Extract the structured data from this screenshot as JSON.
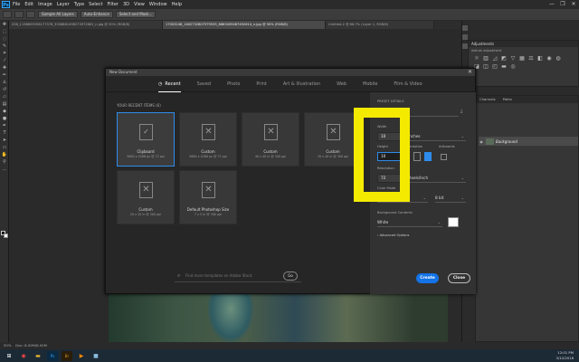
{
  "menubar": {
    "logo": "Ps",
    "items": [
      "File",
      "Edit",
      "Image",
      "Layer",
      "Type",
      "Select",
      "Filter",
      "3D",
      "View",
      "Window",
      "Help"
    ],
    "window_controls": [
      "—",
      "❐",
      "✕"
    ]
  },
  "optionsbar": {
    "buttons": [
      "Sample All Layers",
      "Auto-Enhance",
      "Select and Mask..."
    ]
  },
  "doc_tabs": [
    "036_1138609356177378_3336861498273972661_n.jpg @ 50% (RGB/8)",
    "17003248_1462732807979555_6863459487492614_n.jpg @ 50% (RGB/8)",
    "Untitled-2 @ 66.7% (Layer 1, RGB/8)"
  ],
  "adjustments": {
    "title": "Adjustments",
    "subtitle": "Add an adjustment"
  },
  "layers": {
    "tabs": [
      "Channels",
      "Paths"
    ],
    "background_label": "Background"
  },
  "statusbar": {
    "zoom": "50%",
    "doc": "Doc: 8.00M/8.00M"
  },
  "taskbar": {
    "time": "12:01 PM",
    "date": "3/12/2018"
  },
  "dialog": {
    "title": "New Document",
    "close": "✕",
    "tabs": [
      "Recent",
      "Saved",
      "Photo",
      "Print",
      "Art & Illustration",
      "Web",
      "Mobile",
      "Film & Video"
    ],
    "recent_header": "YOUR RECENT ITEMS (6)",
    "cards": [
      {
        "name": "Clipboard",
        "size": "5680 x 4288 px @ 72 ppi"
      },
      {
        "name": "Custom",
        "size": "5680 x 4288 px @ 72 ppi"
      },
      {
        "name": "Custom",
        "size": "40 x 40 in @ 300 ppi"
      },
      {
        "name": "Custom",
        "size": "20 x 40 in @ 300 ppi"
      },
      {
        "name": "Custom",
        "size": "20 x 20 in @ 300 ppi"
      },
      {
        "name": "Default Photoshop Size",
        "size": "7 x 5 in @ 300 ppi"
      }
    ],
    "search_placeholder": "Find more templates on Adobe Stock",
    "go": "Go",
    "preset": {
      "header": "PRESET DETAILS",
      "name_value": "Untitled-1",
      "width_label": "Width",
      "width_value": "10",
      "width_unit": "Inches",
      "height_label": "Height",
      "height_value": "10",
      "orientation_label": "Orientation",
      "artboards_label": "Artboards",
      "resolution_label": "Resolution",
      "resolution_value": "72",
      "resolution_unit": "Pixels/Inch",
      "colormode_label": "Color Mode",
      "colormode_value": "RGB Color",
      "bitdepth_value": "8 bit",
      "bg_label": "Background Contents",
      "bg_value": "White",
      "advanced": "Advanced Options"
    },
    "create": "Create",
    "close_btn": "Close"
  },
  "colors": {
    "accent": "#2d8ceb",
    "highlight": "#f4ea00",
    "create": "#1473e6"
  }
}
